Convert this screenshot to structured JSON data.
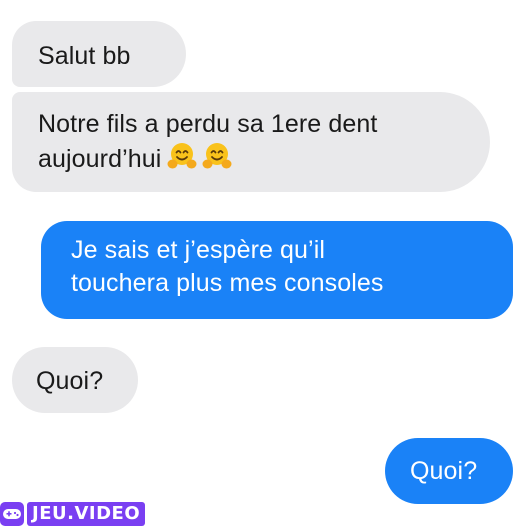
{
  "conversation": {
    "messages": [
      {
        "direction": "incoming",
        "text": "Salut bb"
      },
      {
        "direction": "incoming",
        "text_line1": "Notre fils a perdu sa 1ere dent",
        "text_line2": "aujourd’hui",
        "emojis": [
          "hugging-face-emoji",
          "hugging-face-emoji"
        ]
      },
      {
        "direction": "outgoing",
        "text_line1": "Je sais et j’espère qu’il",
        "text_line2": "touchera plus mes consoles"
      },
      {
        "direction": "incoming",
        "text": "Quoi?"
      },
      {
        "direction": "outgoing",
        "text": "Quoi?"
      }
    ]
  },
  "colors": {
    "incoming_bubble": "#e9e9eb",
    "outgoing_bubble": "#1a82f7",
    "watermark": "#7a3ff2"
  },
  "watermark": {
    "text": "JEU.VIDEO",
    "icon": "gamepad-icon"
  }
}
